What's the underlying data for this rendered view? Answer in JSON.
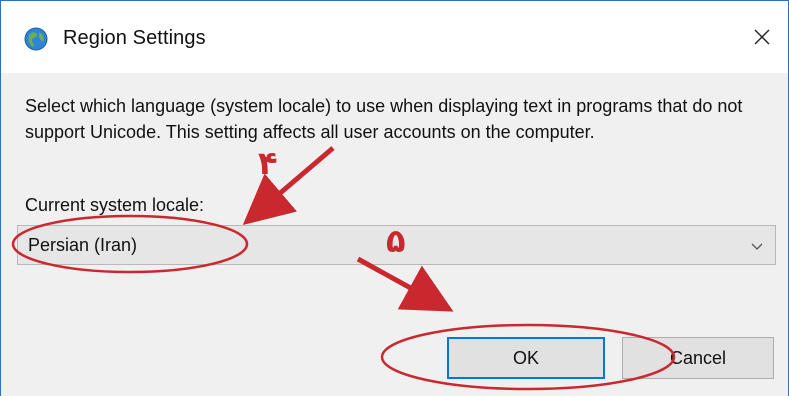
{
  "window": {
    "title": "Region Settings",
    "close_glyph": "✕"
  },
  "dialog": {
    "description": "Select which language (system locale) to use when displaying text in programs that do not support Unicode. This setting affects all user accounts on the computer.",
    "locale_label": "Current system locale:",
    "locale_value": "Persian (Iran)"
  },
  "buttons": {
    "ok": "OK",
    "cancel": "Cancel"
  },
  "annotations": {
    "step_1": "۴",
    "step_2": "۵",
    "color": "#c8282e"
  },
  "icons": {
    "app": "globe-icon",
    "close": "close-icon",
    "dropdown": "chevron-down-icon"
  }
}
